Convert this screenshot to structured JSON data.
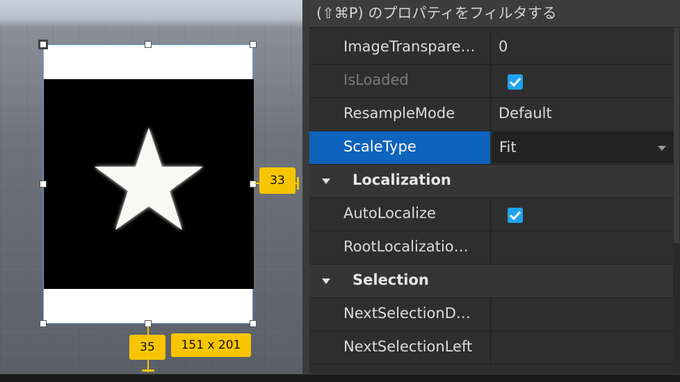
{
  "viewport": {
    "anchor_offset_x": "35",
    "anchor_offset_y": "33",
    "selection_size": "151 x 201"
  },
  "properties": {
    "filter_placeholder": "(⇧⌘P) のプロパティをフィルタする",
    "rows": [
      {
        "name": "ImageTranspare…",
        "value": "0"
      },
      {
        "name": "IsLoaded",
        "checked": true,
        "disabled": true
      },
      {
        "name": "ResampleMode",
        "value": "Default"
      },
      {
        "name": "ScaleType",
        "value": "Fit",
        "selected": true
      }
    ],
    "sections": [
      {
        "title": "Localization",
        "rows": [
          {
            "name": "AutoLocalize",
            "checked": true
          },
          {
            "name": "RootLocalizatio…",
            "value": ""
          }
        ]
      },
      {
        "title": "Selection",
        "rows": [
          {
            "name": "NextSelectionD…",
            "value": ""
          },
          {
            "name": "NextSelectionLeft",
            "value": ""
          }
        ]
      }
    ]
  },
  "colors": {
    "selection_accent": "#0e63bd",
    "checkbox": "#1fa3f0",
    "badge": "#f7c500"
  },
  "icons": {
    "checkbox": "check-icon",
    "section_toggle": "triangle-down-icon",
    "dropdown": "chevron-down-icon"
  }
}
